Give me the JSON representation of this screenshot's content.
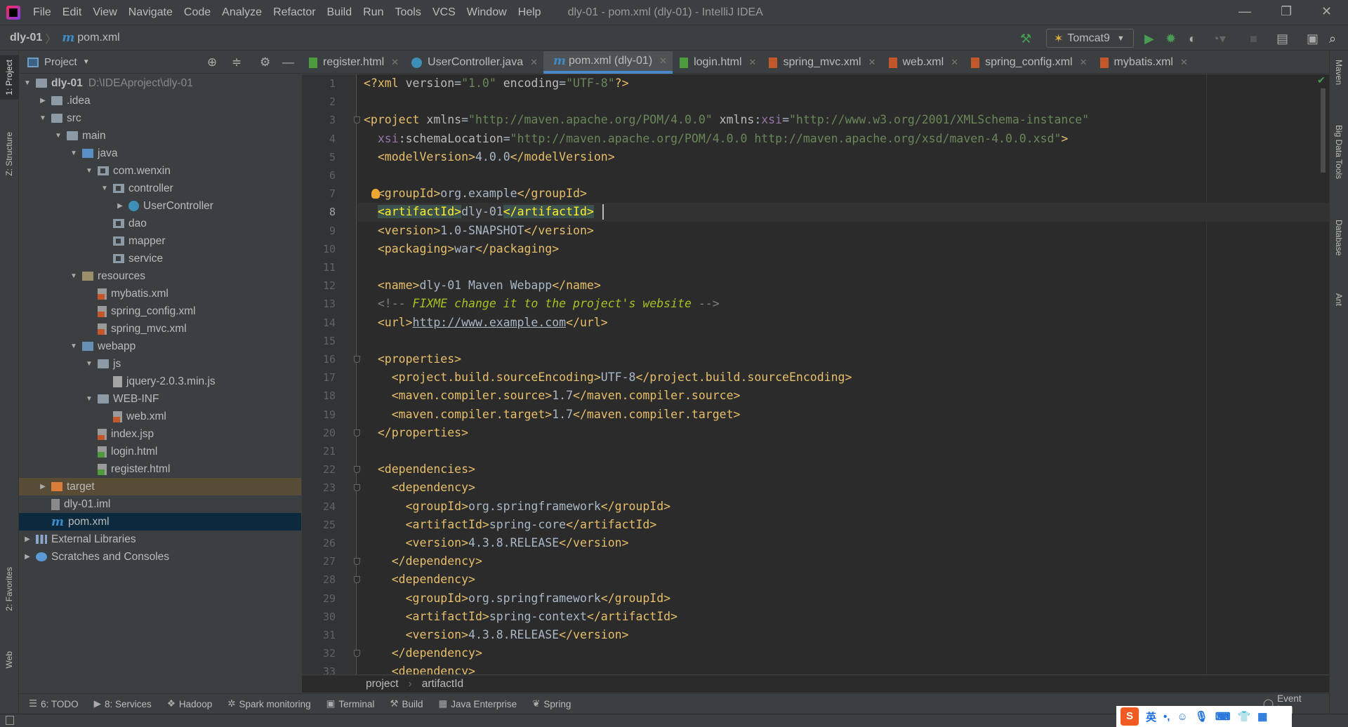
{
  "window": {
    "title": "dly-01 - pom.xml (dly-01) - IntelliJ IDEA",
    "menu": [
      "File",
      "Edit",
      "View",
      "Navigate",
      "Code",
      "Analyze",
      "Refactor",
      "Build",
      "Run",
      "Tools",
      "VCS",
      "Window",
      "Help"
    ]
  },
  "navbar": {
    "project": "dly-01",
    "file": "pom.xml",
    "run_config": "Tomcat9"
  },
  "project_panel": {
    "title": "Project",
    "items": [
      {
        "level": 0,
        "arrow": "open",
        "icon": "module-folder",
        "label": "dly-01",
        "path": "D:\\IDEAproject\\dly-01"
      },
      {
        "level": 1,
        "arrow": "closed",
        "icon": "folder",
        "label": ".idea"
      },
      {
        "level": 1,
        "arrow": "open",
        "icon": "folder",
        "label": "src"
      },
      {
        "level": 2,
        "arrow": "open",
        "icon": "folder",
        "label": "main"
      },
      {
        "level": 3,
        "arrow": "open",
        "icon": "src",
        "label": "java"
      },
      {
        "level": 4,
        "arrow": "open",
        "icon": "pkg",
        "label": "com.wenxin"
      },
      {
        "level": 5,
        "arrow": "open",
        "icon": "pkg",
        "label": "controller"
      },
      {
        "level": 6,
        "arrow": "closed",
        "icon": "cls",
        "label": "UserController"
      },
      {
        "level": 5,
        "arrow": "",
        "icon": "pkg",
        "label": "dao"
      },
      {
        "level": 5,
        "arrow": "",
        "icon": "pkg",
        "label": "mapper"
      },
      {
        "level": 5,
        "arrow": "",
        "icon": "pkg",
        "label": "service"
      },
      {
        "level": 3,
        "arrow": "open",
        "icon": "res",
        "label": "resources"
      },
      {
        "level": 4,
        "arrow": "",
        "icon": "xml",
        "label": "mybatis.xml"
      },
      {
        "level": 4,
        "arrow": "",
        "icon": "xml",
        "label": "spring_config.xml"
      },
      {
        "level": 4,
        "arrow": "",
        "icon": "xml",
        "label": "spring_mvc.xml"
      },
      {
        "level": 3,
        "arrow": "open",
        "icon": "web",
        "label": "webapp"
      },
      {
        "level": 4,
        "arrow": "open",
        "icon": "folder",
        "label": "js"
      },
      {
        "level": 5,
        "arrow": "",
        "icon": "js",
        "label": "jquery-2.0.3.min.js"
      },
      {
        "level": 4,
        "arrow": "open",
        "icon": "folder",
        "label": "WEB-INF"
      },
      {
        "level": 5,
        "arrow": "",
        "icon": "xml",
        "label": "web.xml"
      },
      {
        "level": 4,
        "arrow": "",
        "icon": "jsp",
        "label": "index.jsp"
      },
      {
        "level": 4,
        "arrow": "",
        "icon": "html",
        "label": "login.html"
      },
      {
        "level": 4,
        "arrow": "",
        "icon": "html",
        "label": "register.html"
      },
      {
        "level": 1,
        "arrow": "closed",
        "icon": "target",
        "label": "target",
        "state": "excluded"
      },
      {
        "level": 1,
        "arrow": "",
        "icon": "iml",
        "label": "dly-01.iml"
      },
      {
        "level": 1,
        "arrow": "",
        "icon": "maven",
        "label": "pom.xml",
        "state": "selected"
      },
      {
        "level": 0,
        "arrow": "closed",
        "icon": "lib",
        "label": "External Libraries"
      },
      {
        "level": 0,
        "arrow": "closed",
        "icon": "scr",
        "label": "Scratches and Consoles"
      }
    ]
  },
  "tabs": [
    {
      "label": "register.html",
      "icon": "html"
    },
    {
      "label": "UserController.java",
      "icon": "cls"
    },
    {
      "label": "pom.xml (dly-01)",
      "icon": "maven",
      "active": true
    },
    {
      "label": "login.html",
      "icon": "html"
    },
    {
      "label": "spring_mvc.xml",
      "icon": "xml"
    },
    {
      "label": "web.xml",
      "icon": "xml"
    },
    {
      "label": "spring_config.xml",
      "icon": "xml"
    },
    {
      "label": "mybatis.xml",
      "icon": "xml"
    }
  ],
  "editor": {
    "current_line": 8,
    "fold_lines": [
      3,
      16,
      20,
      22,
      23,
      27,
      28,
      32
    ],
    "lines": [
      [
        [
          "t",
          "<?xml "
        ],
        [
          "a",
          "version"
        ],
        [
          "x",
          "="
        ],
        [
          "v",
          "\"1.0\""
        ],
        [
          "a",
          " encoding"
        ],
        [
          "x",
          "="
        ],
        [
          "v",
          "\"UTF-8\""
        ],
        [
          "t",
          "?>"
        ]
      ],
      [],
      [
        [
          "t",
          "<project "
        ],
        [
          "a",
          "xmlns"
        ],
        [
          "x",
          "="
        ],
        [
          "v",
          "\"http://maven.apache.org/POM/4.0.0\""
        ],
        [
          "a",
          " xmlns"
        ],
        [
          "x",
          ":"
        ],
        [
          "n",
          "xsi"
        ],
        [
          "x",
          "="
        ],
        [
          "v",
          "\"http://www.w3.org/2001/XMLSchema-instance\""
        ]
      ],
      [
        [
          "x",
          "  "
        ],
        [
          "n",
          "xsi"
        ],
        [
          "a",
          ":schemaLocation"
        ],
        [
          "x",
          "="
        ],
        [
          "v",
          "\"http://maven.apache.org/POM/4.0.0 http://maven.apache.org/xsd/maven-4.0.0.xsd\""
        ],
        [
          "t",
          ">"
        ]
      ],
      [
        [
          "x",
          "  "
        ],
        [
          "t",
          "<modelVersion>"
        ],
        [
          "x",
          "4.0.0"
        ],
        [
          "t",
          "</modelVersion>"
        ]
      ],
      [],
      [
        [
          "x",
          "  "
        ],
        [
          "t",
          "<groupId>"
        ],
        [
          "x",
          "org.example"
        ],
        [
          "t",
          "</groupId>"
        ]
      ],
      [
        [
          "x",
          "  "
        ],
        [
          "m",
          "<artifactId>"
        ],
        [
          "x",
          "dly-01"
        ],
        [
          "m",
          "</artifactId>"
        ]
      ],
      [
        [
          "x",
          "  "
        ],
        [
          "t",
          "<version>"
        ],
        [
          "x",
          "1.0-SNAPSHOT"
        ],
        [
          "t",
          "</version>"
        ]
      ],
      [
        [
          "x",
          "  "
        ],
        [
          "t",
          "<packaging>"
        ],
        [
          "x",
          "war"
        ],
        [
          "t",
          "</packaging>"
        ]
      ],
      [],
      [
        [
          "x",
          "  "
        ],
        [
          "t",
          "<name>"
        ],
        [
          "x",
          "dly-01 Maven Webapp"
        ],
        [
          "t",
          "</name>"
        ]
      ],
      [
        [
          "x",
          "  "
        ],
        [
          "c",
          "<!-- "
        ],
        [
          "f",
          "FIXME change it to the project's website"
        ],
        [
          "c",
          " -->"
        ]
      ],
      [
        [
          "x",
          "  "
        ],
        [
          "t",
          "<url>"
        ],
        [
          "u",
          "http://www.example.com"
        ],
        [
          "t",
          "</url>"
        ]
      ],
      [],
      [
        [
          "x",
          "  "
        ],
        [
          "t",
          "<properties>"
        ]
      ],
      [
        [
          "x",
          "    "
        ],
        [
          "t",
          "<project.build.sourceEncoding>"
        ],
        [
          "x",
          "UTF-8"
        ],
        [
          "t",
          "</project.build.sourceEncoding>"
        ]
      ],
      [
        [
          "x",
          "    "
        ],
        [
          "t",
          "<maven.compiler.source>"
        ],
        [
          "x",
          "1.7"
        ],
        [
          "t",
          "</maven.compiler.source>"
        ]
      ],
      [
        [
          "x",
          "    "
        ],
        [
          "t",
          "<maven.compiler.target>"
        ],
        [
          "x",
          "1.7"
        ],
        [
          "t",
          "</maven.compiler.target>"
        ]
      ],
      [
        [
          "x",
          "  "
        ],
        [
          "t",
          "</properties>"
        ]
      ],
      [],
      [
        [
          "x",
          "  "
        ],
        [
          "t",
          "<dependencies>"
        ]
      ],
      [
        [
          "x",
          "    "
        ],
        [
          "t",
          "<dependency>"
        ]
      ],
      [
        [
          "x",
          "      "
        ],
        [
          "t",
          "<groupId>"
        ],
        [
          "x",
          "org.springframework"
        ],
        [
          "t",
          "</groupId>"
        ]
      ],
      [
        [
          "x",
          "      "
        ],
        [
          "t",
          "<artifactId>"
        ],
        [
          "x",
          "spring-core"
        ],
        [
          "t",
          "</artifactId>"
        ]
      ],
      [
        [
          "x",
          "      "
        ],
        [
          "t",
          "<version>"
        ],
        [
          "x",
          "4.3.8.RELEASE"
        ],
        [
          "t",
          "</version>"
        ]
      ],
      [
        [
          "x",
          "    "
        ],
        [
          "t",
          "</dependency>"
        ]
      ],
      [
        [
          "x",
          "    "
        ],
        [
          "t",
          "<dependency>"
        ]
      ],
      [
        [
          "x",
          "      "
        ],
        [
          "t",
          "<groupId>"
        ],
        [
          "x",
          "org.springframework"
        ],
        [
          "t",
          "</groupId>"
        ]
      ],
      [
        [
          "x",
          "      "
        ],
        [
          "t",
          "<artifactId>"
        ],
        [
          "x",
          "spring-context"
        ],
        [
          "t",
          "</artifactId>"
        ]
      ],
      [
        [
          "x",
          "      "
        ],
        [
          "t",
          "<version>"
        ],
        [
          "x",
          "4.3.8.RELEASE"
        ],
        [
          "t",
          "</version>"
        ]
      ],
      [
        [
          "x",
          "    "
        ],
        [
          "t",
          "</dependency>"
        ]
      ],
      [
        [
          "x",
          "    "
        ],
        [
          "t",
          "<dependency>"
        ]
      ]
    ]
  },
  "breadcrumb": [
    "project",
    "artifactId"
  ],
  "left_strip": [
    "1: Project",
    "Z: Structure",
    "2: Favorites",
    "Web"
  ],
  "right_strip": [
    "Maven",
    "Big Data Tools",
    "Database",
    "Ant"
  ],
  "bottom_tools": [
    "6: TODO",
    "8: Services",
    "Hadoop",
    "Spark monitoring",
    "Terminal",
    "Build",
    "Java Enterprise",
    "Spring"
  ],
  "event_log": "Event Log",
  "ime": {
    "mode": "英"
  },
  "colors": {
    "editor_bg": "#2b2b2b",
    "tag": "#e8bf6a",
    "string": "#6a8759",
    "text": "#a9b7c6",
    "selection": "#0d293e",
    "accent": "#4a88c7"
  }
}
